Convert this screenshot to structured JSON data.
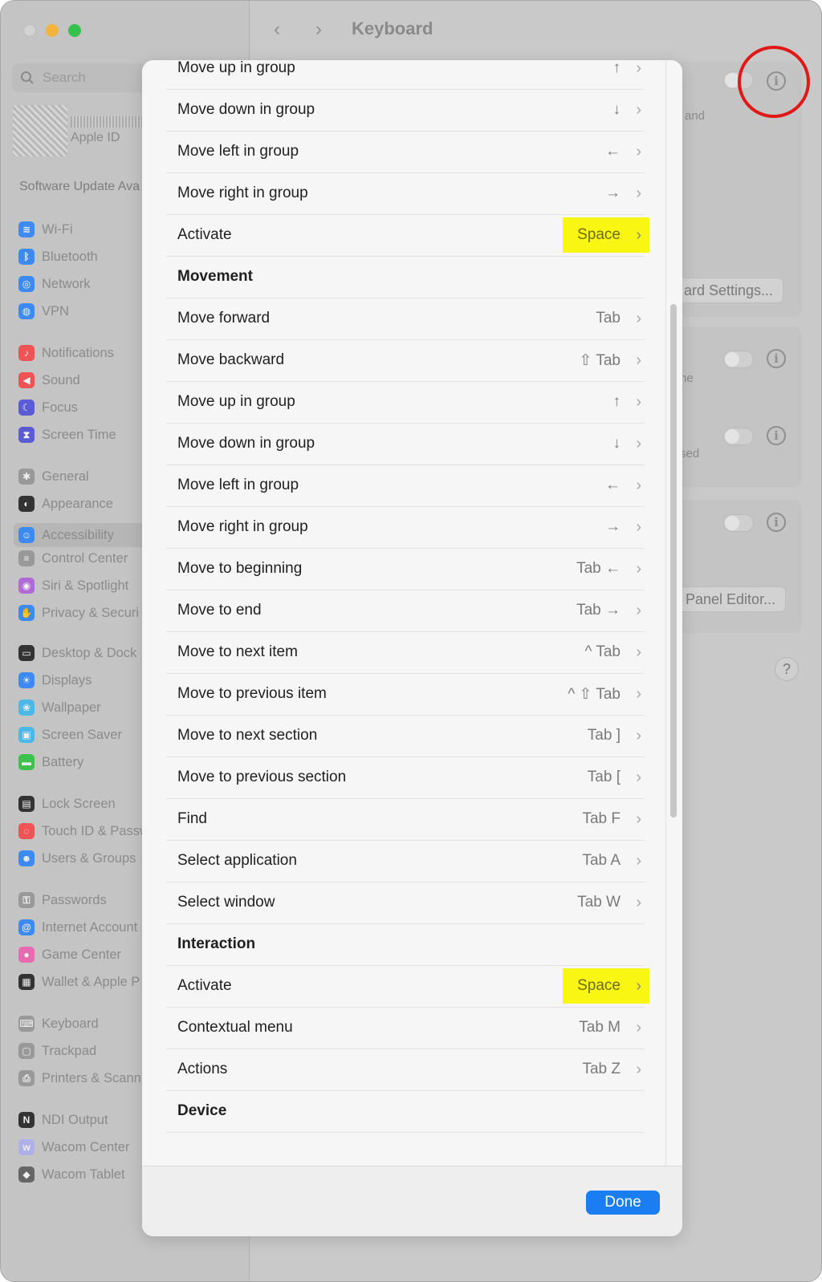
{
  "window": {
    "title": "Keyboard"
  },
  "sidebar": {
    "search_placeholder": "Search",
    "apple_id": "Apple ID",
    "software_update": "Software Update Ava",
    "items": [
      {
        "label": "Wi-Fi",
        "icon": "wifi-icon",
        "color": "#3d8bf2"
      },
      {
        "label": "Bluetooth",
        "icon": "bluetooth-icon",
        "color": "#3d8bf2"
      },
      {
        "label": "Network",
        "icon": "globe-icon",
        "color": "#3d8bf2"
      },
      {
        "label": "VPN",
        "icon": "vpn-icon",
        "color": "#3d8bf2"
      },
      {
        "label": "Notifications",
        "icon": "bell-icon",
        "color": "#ef5353"
      },
      {
        "label": "Sound",
        "icon": "speaker-icon",
        "color": "#ef5353"
      },
      {
        "label": "Focus",
        "icon": "moon-icon",
        "color": "#5b5bd6"
      },
      {
        "label": "Screen Time",
        "icon": "hourglass-icon",
        "color": "#5b5bd6"
      },
      {
        "label": "General",
        "icon": "gear-icon",
        "color": "#999999"
      },
      {
        "label": "Appearance",
        "icon": "appearance-icon",
        "color": "#333333"
      },
      {
        "label": "Accessibility",
        "icon": "accessibility-icon",
        "color": "#3d8bf2"
      },
      {
        "label": "Control Center",
        "icon": "control-center-icon",
        "color": "#999999"
      },
      {
        "label": "Siri & Spotlight",
        "icon": "siri-icon",
        "color": "#b06ad6"
      },
      {
        "label": "Privacy & Securi",
        "icon": "hand-icon",
        "color": "#3d8bf2"
      },
      {
        "label": "Desktop & Dock",
        "icon": "dock-icon",
        "color": "#333333"
      },
      {
        "label": "Displays",
        "icon": "sun-icon",
        "color": "#3d8bf2"
      },
      {
        "label": "Wallpaper",
        "icon": "wallpaper-icon",
        "color": "#4cb8e8"
      },
      {
        "label": "Screen Saver",
        "icon": "screensaver-icon",
        "color": "#4cb8e8"
      },
      {
        "label": "Battery",
        "icon": "battery-icon",
        "color": "#3cc24c"
      },
      {
        "label": "Lock Screen",
        "icon": "lock-icon",
        "color": "#333333"
      },
      {
        "label": "Touch ID & Passw",
        "icon": "fingerprint-icon",
        "color": "#ef5353"
      },
      {
        "label": "Users & Groups",
        "icon": "users-icon",
        "color": "#3d8bf2"
      },
      {
        "label": "Passwords",
        "icon": "key-icon",
        "color": "#999999"
      },
      {
        "label": "Internet Account",
        "icon": "at-icon",
        "color": "#3d8bf2"
      },
      {
        "label": "Game Center",
        "icon": "game-center-icon",
        "color": "#e86ab0"
      },
      {
        "label": "Wallet & Apple P",
        "icon": "wallet-icon",
        "color": "#333333"
      },
      {
        "label": "Keyboard",
        "icon": "keyboard-icon",
        "color": "#999999"
      },
      {
        "label": "Trackpad",
        "icon": "trackpad-icon",
        "color": "#999999"
      },
      {
        "label": "Printers & Scann",
        "icon": "printer-icon",
        "color": "#999999"
      },
      {
        "label": "NDI Output",
        "icon": "ndi-icon",
        "color": "#333333"
      },
      {
        "label": "Wacom Center",
        "icon": "wacom-icon",
        "color": "#b0b0e8"
      },
      {
        "label": "Wacom Tablet",
        "icon": "tablet-icon",
        "color": "#666666"
      }
    ]
  },
  "background": {
    "text_and": "and",
    "button_keyboard_settings": "ard Settings...",
    "text_ne": "ne",
    "text_sed": "sed",
    "button_panel_editor": "Panel Editor...",
    "help": "?"
  },
  "modal": {
    "rows": [
      {
        "label": "Move up in group",
        "shortcut": "↑",
        "header": false,
        "highlight": false
      },
      {
        "label": "Move down in group",
        "shortcut": "↓",
        "header": false,
        "highlight": false
      },
      {
        "label": "Move left in group",
        "shortcut": "←",
        "header": false,
        "highlight": false
      },
      {
        "label": "Move right in group",
        "shortcut": "→",
        "header": false,
        "highlight": false
      },
      {
        "label": "Activate",
        "shortcut": "Space",
        "header": false,
        "highlight": true
      },
      {
        "label": "Movement",
        "shortcut": "",
        "header": true,
        "highlight": false
      },
      {
        "label": "Move forward",
        "shortcut": "Tab",
        "header": false,
        "highlight": false
      },
      {
        "label": "Move backward",
        "shortcut": "⇧ Tab",
        "header": false,
        "highlight": false
      },
      {
        "label": "Move up in group",
        "shortcut": "↑",
        "header": false,
        "highlight": false
      },
      {
        "label": "Move down in group",
        "shortcut": "↓",
        "header": false,
        "highlight": false
      },
      {
        "label": "Move left in group",
        "shortcut": "←",
        "header": false,
        "highlight": false
      },
      {
        "label": "Move right in group",
        "shortcut": "→",
        "header": false,
        "highlight": false
      },
      {
        "label": "Move to beginning",
        "shortcut": "Tab ←",
        "header": false,
        "highlight": false
      },
      {
        "label": "Move to end",
        "shortcut": "Tab →",
        "header": false,
        "highlight": false
      },
      {
        "label": "Move to next item",
        "shortcut": "^ Tab",
        "header": false,
        "highlight": false
      },
      {
        "label": "Move to previous item",
        "shortcut": "^ ⇧ Tab",
        "header": false,
        "highlight": false
      },
      {
        "label": "Move to next section",
        "shortcut": "Tab ]",
        "header": false,
        "highlight": false
      },
      {
        "label": "Move to previous section",
        "shortcut": "Tab [",
        "header": false,
        "highlight": false
      },
      {
        "label": "Find",
        "shortcut": "Tab F",
        "header": false,
        "highlight": false
      },
      {
        "label": "Select application",
        "shortcut": "Tab A",
        "header": false,
        "highlight": false
      },
      {
        "label": "Select window",
        "shortcut": "Tab W",
        "header": false,
        "highlight": false
      },
      {
        "label": "Interaction",
        "shortcut": "",
        "header": true,
        "highlight": false
      },
      {
        "label": "Activate",
        "shortcut": "Space",
        "header": false,
        "highlight": true
      },
      {
        "label": "Contextual menu",
        "shortcut": "Tab M",
        "header": false,
        "highlight": false
      },
      {
        "label": "Actions",
        "shortcut": "Tab Z",
        "header": false,
        "highlight": false
      },
      {
        "label": "Device",
        "shortcut": "",
        "header": true,
        "highlight": false
      }
    ],
    "done_label": "Done"
  },
  "colors": {
    "highlight": "#faf614",
    "accent": "#1a7ef2",
    "annotation_circle": "#e01818"
  }
}
